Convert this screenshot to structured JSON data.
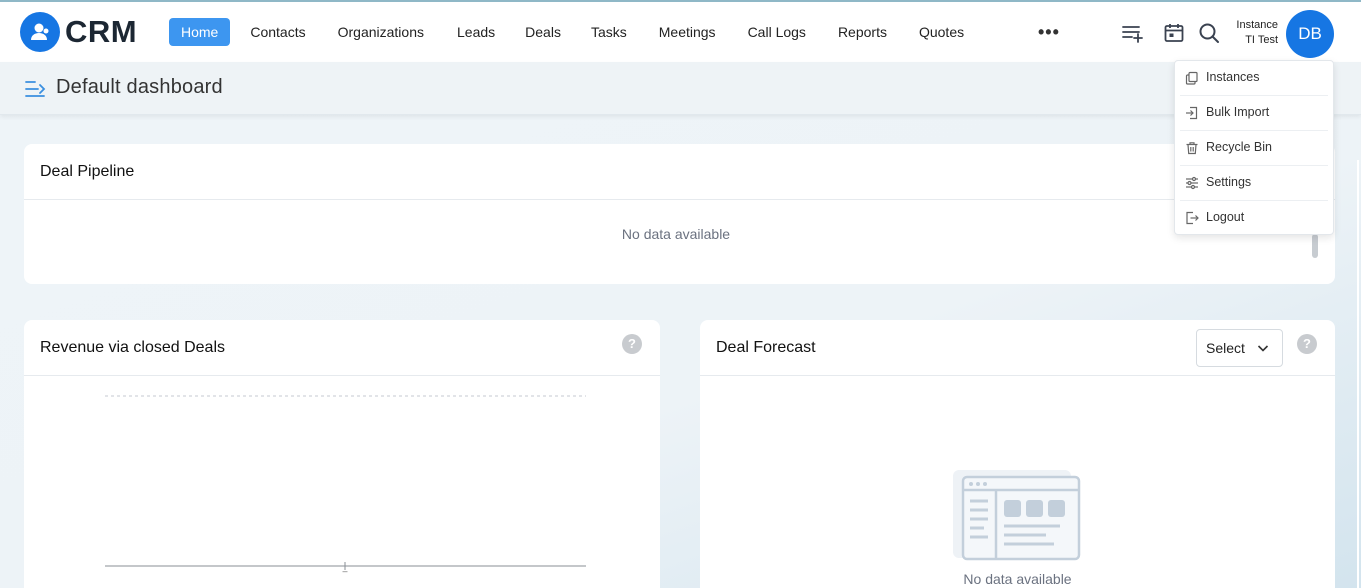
{
  "brand": {
    "name": "CRM"
  },
  "nav": {
    "items": [
      {
        "label": "Home",
        "active": true
      },
      {
        "label": "Contacts"
      },
      {
        "label": "Organizations"
      },
      {
        "label": "Leads"
      },
      {
        "label": "Deals"
      },
      {
        "label": "Tasks"
      },
      {
        "label": "Meetings"
      },
      {
        "label": "Call Logs"
      },
      {
        "label": "Reports"
      },
      {
        "label": "Quotes"
      }
    ],
    "more": "•••"
  },
  "user": {
    "instance_line1": "Instance",
    "instance_line2": "TI Test",
    "initials": "DB"
  },
  "page": {
    "title": "Default dashboard"
  },
  "dropdown": {
    "items": [
      {
        "label": "Instances",
        "icon": "copy-icon"
      },
      {
        "label": "Bulk Import",
        "icon": "import-icon"
      },
      {
        "label": "Recycle Bin",
        "icon": "trash-icon"
      },
      {
        "label": "Settings",
        "icon": "sliders-icon"
      },
      {
        "label": "Logout",
        "icon": "logout-icon"
      }
    ]
  },
  "cards": {
    "pipeline": {
      "title": "Deal Pipeline",
      "empty": "No data available"
    },
    "revenue": {
      "title": "Revenue via closed Deals",
      "help": "?",
      "axis_tick": "–"
    },
    "forecast": {
      "title": "Deal Forecast",
      "select": "Select",
      "help": "?",
      "empty": "No data available"
    }
  },
  "colors": {
    "accent": "#1676e3",
    "nav_active": "#3d96f0"
  }
}
